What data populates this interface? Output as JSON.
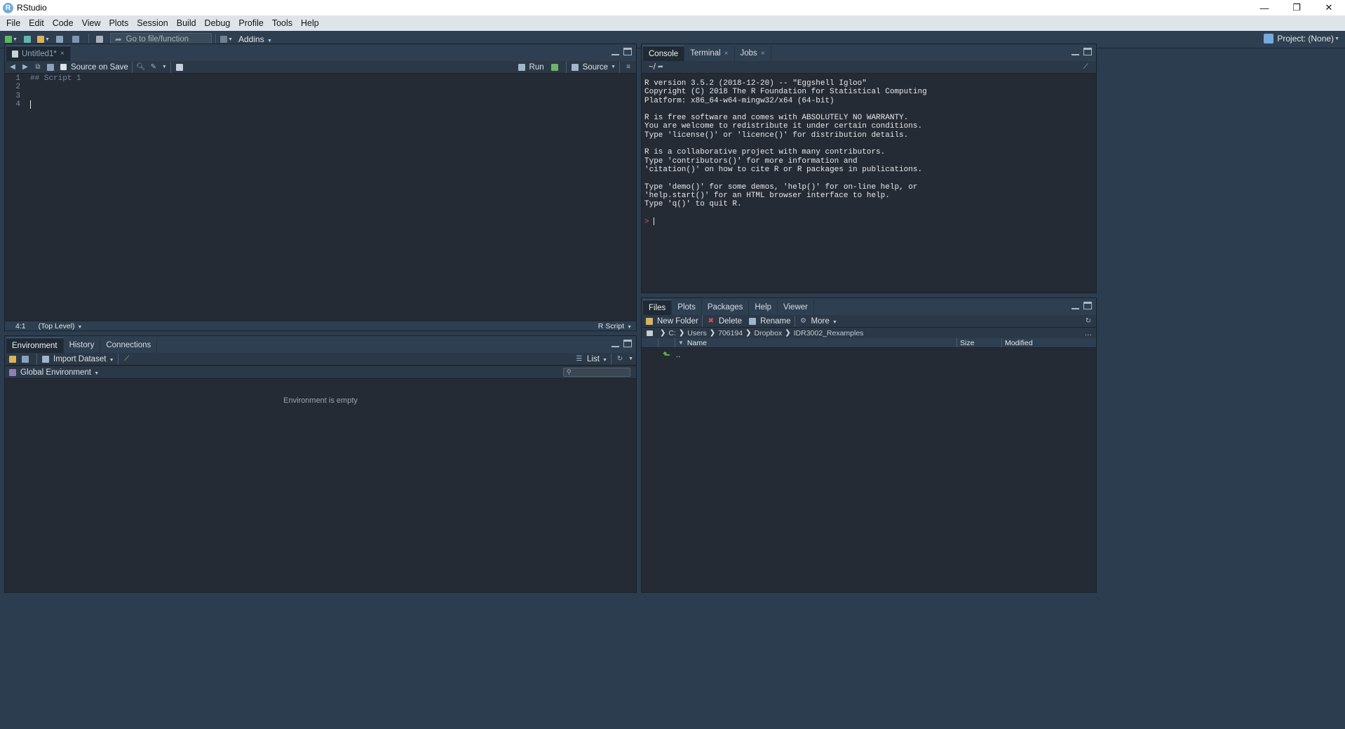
{
  "window": {
    "title": "RStudio",
    "logo_letter": "R",
    "controls": {
      "minimize": "—",
      "maximize": "❐",
      "close": "✕"
    }
  },
  "menu": [
    "File",
    "Edit",
    "Code",
    "View",
    "Plots",
    "Session",
    "Build",
    "Debug",
    "Profile",
    "Tools",
    "Help"
  ],
  "toolbar": {
    "goto_placeholder": "Go to file/function",
    "addins_label": "Addins",
    "project_label": "Project: (None)"
  },
  "source": {
    "tabs": [
      {
        "label": "Untitled1*",
        "close": "×"
      }
    ],
    "source_on_save": "Source on Save",
    "run_label": "Run",
    "source_label": "Source",
    "lines": [
      {
        "num": "1",
        "text": "## Script 1"
      },
      {
        "num": "2",
        "text": ""
      },
      {
        "num": "3",
        "text": ""
      },
      {
        "num": "4",
        "text": ""
      }
    ],
    "status": {
      "position": "4:1",
      "scope": "(Top Level)",
      "filetype": "R Script"
    }
  },
  "environment": {
    "tabs": [
      "Environment",
      "History",
      "Connections"
    ],
    "import_dataset": "Import Dataset",
    "view_mode": "List",
    "scope": "Global Environment",
    "empty_message": "Environment is empty"
  },
  "console": {
    "tabs": [
      {
        "label": "Console",
        "close": ""
      },
      {
        "label": "Terminal",
        "close": "×"
      },
      {
        "label": "Jobs",
        "close": "×"
      }
    ],
    "path": "~/",
    "text": "R version 3.5.2 (2018-12-20) -- \"Eggshell Igloo\"\nCopyright (C) 2018 The R Foundation for Statistical Computing\nPlatform: x86_64-w64-mingw32/x64 (64-bit)\n\nR is free software and comes with ABSOLUTELY NO WARRANTY.\nYou are welcome to redistribute it under certain conditions.\nType 'license()' or 'licence()' for distribution details.\n\nR is a collaborative project with many contributors.\nType 'contributors()' for more information and\n'citation()' on how to cite R or R packages in publications.\n\nType 'demo()' for some demos, 'help()' for on-line help, or\n'help.start()' for an HTML browser interface to help.\nType 'q()' to quit R.\n",
    "prompt": ">"
  },
  "files": {
    "tabs": [
      "Files",
      "Plots",
      "Packages",
      "Help",
      "Viewer"
    ],
    "new_folder": "New Folder",
    "delete": "Delete",
    "rename": "Rename",
    "more": "More",
    "breadcrumb": [
      "C:",
      "Users",
      "706194",
      "Dropbox",
      "IDR3002_Rexamples"
    ],
    "columns": {
      "name": "Name",
      "size": "Size",
      "modified": "Modified"
    },
    "rows": [
      {
        "name": ".."
      }
    ]
  }
}
